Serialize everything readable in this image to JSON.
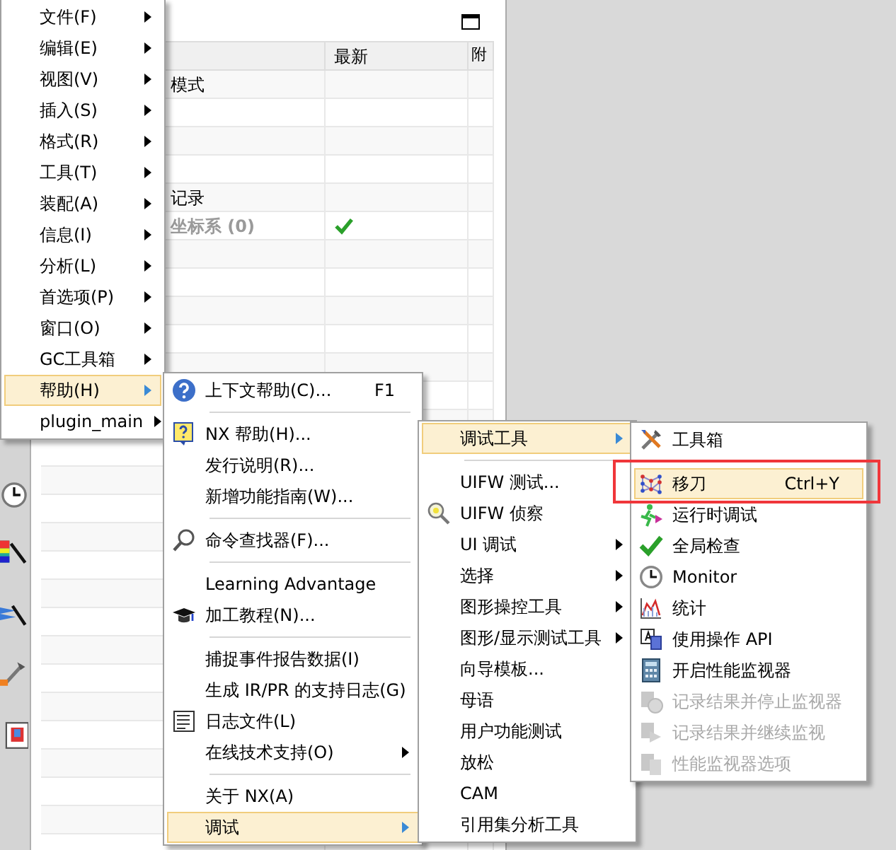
{
  "panel": {
    "columns": [
      {},
      {
        "label": "最新"
      },
      {
        "label": "附"
      }
    ],
    "rows": [
      {
        "cells": [
          "模式",
          "",
          ""
        ],
        "greyed": false
      },
      {
        "cells": [
          "",
          "",
          ""
        ]
      },
      {
        "cells": [
          "",
          "",
          ""
        ]
      },
      {
        "cells": [
          "",
          "",
          ""
        ]
      },
      {
        "cells": [
          "记录",
          "",
          ""
        ],
        "greyed": false
      },
      {
        "cells": [
          "坐标系 (0)",
          "",
          ""
        ],
        "greyed": true,
        "latest": true
      },
      {
        "cells": [
          "",
          "",
          ""
        ]
      },
      {
        "cells": [
          "",
          "",
          ""
        ]
      },
      {
        "cells": [
          "",
          "",
          ""
        ]
      },
      {
        "cells": [
          "",
          "",
          ""
        ]
      },
      {
        "cells": [
          "",
          "",
          ""
        ]
      },
      {
        "cells": [
          "",
          "",
          ""
        ]
      },
      {
        "cells": [
          "",
          "",
          ""
        ]
      },
      {
        "cells": [
          "",
          "",
          ""
        ]
      },
      {
        "cells": [
          "",
          "",
          ""
        ]
      },
      {
        "cells": [
          "",
          "",
          ""
        ]
      },
      {
        "cells": [
          "",
          "",
          ""
        ]
      },
      {
        "cells": [
          "",
          "",
          ""
        ]
      },
      {
        "cells": [
          "",
          "",
          ""
        ]
      },
      {
        "cells": [
          "",
          "",
          ""
        ]
      },
      {
        "cells": [
          "",
          "",
          ""
        ]
      },
      {
        "cells": [
          "",
          "",
          ""
        ]
      },
      {
        "cells": [
          "",
          "",
          ""
        ]
      },
      {
        "cells": [
          "",
          "",
          ""
        ]
      },
      {
        "cells": [
          "",
          "",
          ""
        ]
      },
      {
        "cells": [
          "",
          "",
          ""
        ]
      },
      {
        "cells": [
          "",
          "",
          ""
        ]
      },
      {
        "cells": [
          "",
          "",
          ""
        ]
      }
    ]
  },
  "menus": [
    {
      "items": [
        {
          "kind": "item",
          "label": "文件(F)",
          "submenu": true,
          "selected": false
        },
        {
          "kind": "item",
          "label": "编辑(E)",
          "submenu": true,
          "selected": false
        },
        {
          "kind": "item",
          "label": "视图(V)",
          "submenu": true,
          "selected": false
        },
        {
          "kind": "item",
          "label": "插入(S)",
          "submenu": true,
          "selected": false
        },
        {
          "kind": "item",
          "label": "格式(R)",
          "submenu": true,
          "selected": false
        },
        {
          "kind": "item",
          "label": "工具(T)",
          "submenu": true,
          "selected": false
        },
        {
          "kind": "item",
          "label": "装配(A)",
          "submenu": true,
          "selected": false
        },
        {
          "kind": "item",
          "label": "信息(I)",
          "submenu": true,
          "selected": false
        },
        {
          "kind": "item",
          "label": "分析(L)",
          "submenu": true,
          "selected": false
        },
        {
          "kind": "item",
          "label": "首选项(P)",
          "submenu": true,
          "selected": false
        },
        {
          "kind": "item",
          "label": "窗口(O)",
          "submenu": true,
          "selected": false
        },
        {
          "kind": "item",
          "label": "GC工具箱",
          "submenu": true,
          "selected": false
        },
        {
          "kind": "item",
          "label": "帮助(H)",
          "submenu": true,
          "selected": true
        },
        {
          "kind": "item",
          "label": "plugin_main",
          "submenu": true,
          "selected": false
        }
      ]
    },
    {
      "items": [
        {
          "kind": "item",
          "label": "上下文帮助(C)...",
          "shortcut": "F1",
          "selected": false
        },
        {
          "kind": "separator"
        },
        {
          "kind": "item",
          "label": "NX 帮助(H)...",
          "selected": false
        },
        {
          "kind": "item",
          "label": "发行说明(R)...",
          "selected": false
        },
        {
          "kind": "item",
          "label": "新增功能指南(W)...",
          "selected": false
        },
        {
          "kind": "separator"
        },
        {
          "kind": "item",
          "label": "命令查找器(F)...",
          "selected": false
        },
        {
          "kind": "separator"
        },
        {
          "kind": "item",
          "label": "Learning Advantage",
          "selected": false
        },
        {
          "kind": "item",
          "label": "加工教程(N)...",
          "selected": false
        },
        {
          "kind": "separator"
        },
        {
          "kind": "item",
          "label": "捕捉事件报告数据(I)",
          "selected": false
        },
        {
          "kind": "item",
          "label": "生成 IR/PR 的支持日志(G)",
          "selected": false
        },
        {
          "kind": "item",
          "label": "日志文件(L)",
          "selected": false
        },
        {
          "kind": "item",
          "label": "在线技术支持(O)",
          "submenu": true,
          "selected": false
        },
        {
          "kind": "separator"
        },
        {
          "kind": "item",
          "label": "关于 NX(A)",
          "selected": false
        },
        {
          "kind": "item",
          "label": "调试",
          "submenu": true,
          "selected": true
        }
      ]
    },
    {
      "items": [
        {
          "kind": "item",
          "label": "调试工具",
          "submenu": true,
          "selected": true
        },
        {
          "kind": "separator"
        },
        {
          "kind": "item",
          "label": "UIFW 测试...",
          "selected": false
        },
        {
          "kind": "item",
          "label": "UIFW 侦察",
          "selected": false
        },
        {
          "kind": "item",
          "label": "UI 调试",
          "submenu": true,
          "selected": false
        },
        {
          "kind": "item",
          "label": "选择",
          "submenu": true,
          "selected": false
        },
        {
          "kind": "item",
          "label": "图形操控工具",
          "submenu": true,
          "selected": false
        },
        {
          "kind": "item",
          "label": "图形/显示测试工具",
          "submenu": true,
          "selected": false
        },
        {
          "kind": "item",
          "label": "向导模板...",
          "selected": false
        },
        {
          "kind": "item",
          "label": "母语",
          "selected": false
        },
        {
          "kind": "item",
          "label": "用户功能测试",
          "selected": false
        },
        {
          "kind": "item",
          "label": "放松",
          "selected": false
        },
        {
          "kind": "item",
          "label": "CAM",
          "selected": false
        },
        {
          "kind": "item",
          "label": "引用集分析工具",
          "selected": false
        }
      ]
    },
    {
      "items": [
        {
          "kind": "item",
          "label": "工具箱",
          "selected": false
        },
        {
          "kind": "separator"
        },
        {
          "kind": "item",
          "label": "移刀",
          "shortcut": "Ctrl+Y",
          "selected": true,
          "highlighted": true
        },
        {
          "kind": "item",
          "label": "运行时调试",
          "selected": false
        },
        {
          "kind": "item",
          "label": "全局检查",
          "selected": false
        },
        {
          "kind": "item",
          "label": "Monitor",
          "selected": false
        },
        {
          "kind": "item",
          "label": "统计",
          "selected": false
        },
        {
          "kind": "item",
          "label": "使用操作 API",
          "selected": false
        },
        {
          "kind": "item",
          "label": "开启性能监视器",
          "selected": false
        },
        {
          "kind": "item",
          "label": "记录结果并停止监视器",
          "selected": false,
          "disabled": true
        },
        {
          "kind": "item",
          "label": "记录结果并继续监视",
          "selected": false,
          "disabled": true
        },
        {
          "kind": "item",
          "label": "性能监视器选项",
          "selected": false,
          "disabled": true
        }
      ]
    }
  ]
}
